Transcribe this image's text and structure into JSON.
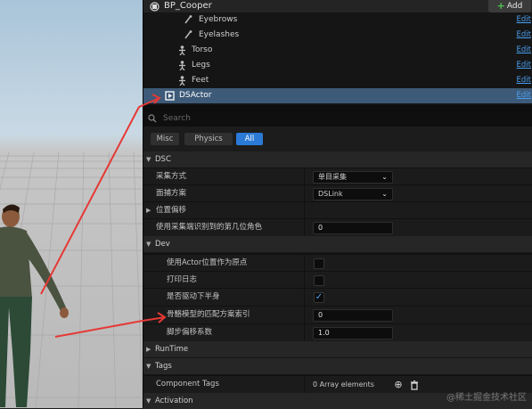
{
  "header": {
    "title": "BP_Cooper",
    "add_label": "Add"
  },
  "components": [
    {
      "label": "Eyebrows",
      "edit": "Edit",
      "icon": "bone-icon"
    },
    {
      "label": "Eyelashes",
      "edit": "Edit",
      "icon": "bone-icon"
    },
    {
      "label": "Torso",
      "edit": "Edit",
      "icon": "skeleton-icon"
    },
    {
      "label": "Legs",
      "edit": "Edit",
      "icon": "skeleton-icon"
    },
    {
      "label": "Feet",
      "edit": "Edit",
      "icon": "skeleton-icon"
    },
    {
      "label": "DSActor",
      "edit": "Edit",
      "icon": "actor-component-icon",
      "selected": true
    }
  ],
  "search": {
    "placeholder": "Search"
  },
  "filters": [
    "Misc",
    "Physics",
    "All"
  ],
  "active_filter": "All",
  "sections": {
    "dsc": "DSC",
    "dev": "Dev",
    "runtime": "RunTime",
    "tags": "Tags",
    "activation": "Activation"
  },
  "dsc_props": {
    "capture_mode_label": "采集方式",
    "capture_mode_value": "单目采集",
    "driver_scheme_label": "面捕方案",
    "driver_scheme_value": "DSLink",
    "offset_label": "位置偏移",
    "role_index_label": "使用采集端识别到的第几位角色",
    "role_index_value": "0"
  },
  "dev_props": {
    "use_actor_origin_label": "使用Actor位置作为原点",
    "use_actor_origin_checked": false,
    "print_log_label": "打印日志",
    "print_log_checked": false,
    "drive_lower_body_label": "是否驱动下半身",
    "drive_lower_body_checked": true,
    "bone_scheme_index_label": "骨骼模型的匹配方案索引",
    "bone_scheme_index_value": "0",
    "foot_offset_label": "脚步偏移系数",
    "foot_offset_value": "1.0"
  },
  "tags_props": {
    "component_tags_label": "Component Tags",
    "component_tags_value": "0 Array elements"
  },
  "colors": {
    "accent": "#2a7ad6",
    "selection": "#3d5a78",
    "arrow": "#e53935",
    "link": "#4a9ef0"
  },
  "watermark": "@稀土掘金技术社区"
}
